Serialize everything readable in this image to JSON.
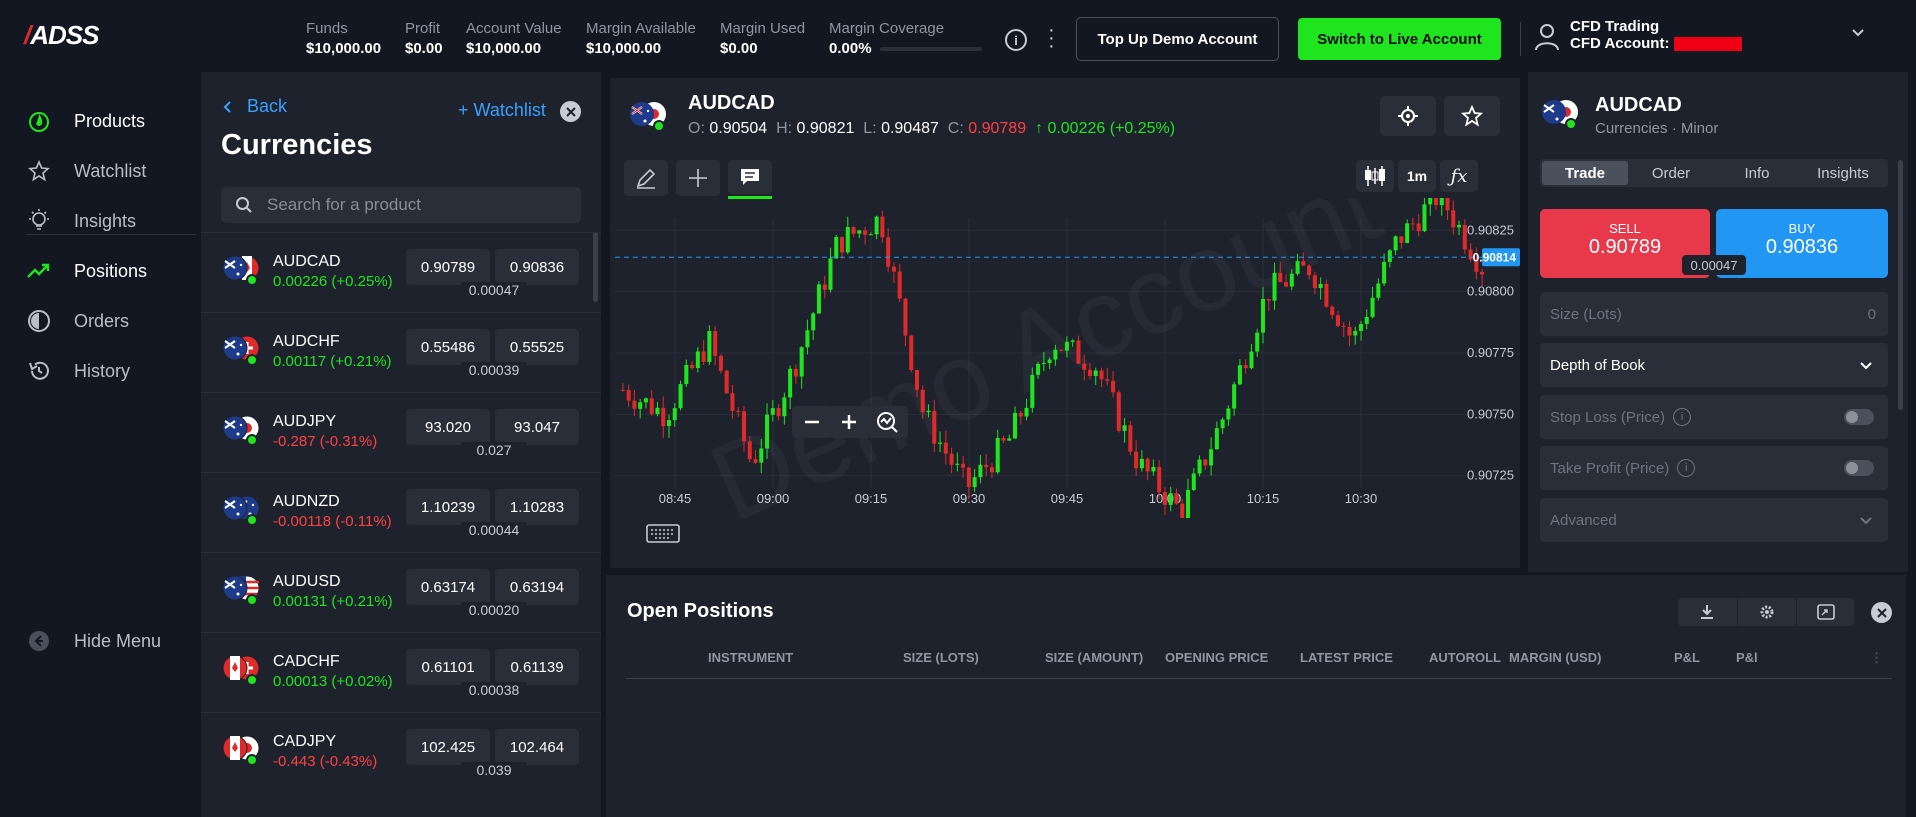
{
  "brand": {
    "logo": "ADSS"
  },
  "stats": [
    {
      "label": "Funds",
      "value": "$10,000.00"
    },
    {
      "label": "Profit",
      "value": "$0.00"
    },
    {
      "label": "Account Value",
      "value": "$10,000.00"
    },
    {
      "label": "Margin Available",
      "value": "$10,000.00"
    },
    {
      "label": "Margin Used",
      "value": "$0.00"
    },
    {
      "label": "Margin Coverage",
      "value": "0.00%"
    }
  ],
  "header": {
    "topup_label": "Top Up Demo Account",
    "live_label": "Switch to Live Account",
    "account_type": "CFD Trading",
    "account_label": "CFD Account:"
  },
  "nav": {
    "items": [
      {
        "label": "Products",
        "icon": "fire-icon"
      },
      {
        "label": "Watchlist",
        "icon": "star-icon"
      },
      {
        "label": "Insights",
        "icon": "bulb-icon"
      },
      {
        "label": "Positions",
        "icon": "trend-icon"
      },
      {
        "label": "Orders",
        "icon": "pie-icon"
      },
      {
        "label": "History",
        "icon": "history-icon"
      }
    ],
    "hide_label": "Hide Menu"
  },
  "productlist": {
    "back_label": "Back",
    "watchlist_label": "+ Watchlist",
    "title": "Currencies",
    "search_placeholder": "Search for a product",
    "items": [
      {
        "name": "AUDCAD",
        "change": "0.00226 (+0.25%)",
        "sell": "0.90789",
        "buy": "0.90836",
        "spread": "0.00047",
        "dir": "up"
      },
      {
        "name": "AUDCHF",
        "change": "0.00117 (+0.21%)",
        "sell": "0.55486",
        "buy": "0.55525",
        "spread": "0.00039",
        "dir": "up"
      },
      {
        "name": "AUDJPY",
        "change": "-0.287 (-0.31%)",
        "sell": "93.020",
        "buy": "93.047",
        "spread": "0.027",
        "dir": "dn"
      },
      {
        "name": "AUDNZD",
        "change": "-0.00118 (-0.11%)",
        "sell": "1.10239",
        "buy": "1.10283",
        "spread": "0.00044",
        "dir": "dn"
      },
      {
        "name": "AUDUSD",
        "change": "0.00131 (+0.21%)",
        "sell": "0.63174",
        "buy": "0.63194",
        "spread": "0.00020",
        "dir": "up"
      },
      {
        "name": "CADCHF",
        "change": "0.00013 (+0.02%)",
        "sell": "0.61101",
        "buy": "0.61139",
        "spread": "0.00038",
        "dir": "up"
      },
      {
        "name": "CADJPY",
        "change": "-0.443 (-0.43%)",
        "sell": "102.425",
        "buy": "102.464",
        "spread": "0.039",
        "dir": "dn"
      }
    ]
  },
  "chart": {
    "symbol": "AUDCAD",
    "o_label": "O:",
    "o": "0.90504",
    "h_label": "H:",
    "h": "0.90821",
    "l_label": "L:",
    "l": "0.90487",
    "c_label": "C:",
    "c": "0.90789",
    "change": "0.00226 (+0.25%)",
    "interval": "1m",
    "current_price": "0.90814",
    "watermark": "Demo Account"
  },
  "chart_data": {
    "type": "candlestick",
    "x_ticks": [
      "08:45",
      "09:00",
      "09:15",
      "09:30",
      "09:45",
      "10:00",
      "10:15",
      "10:30"
    ],
    "y_ticks": [
      "0.90825",
      "0.90800",
      "0.90775",
      "0.90750",
      "0.90725"
    ],
    "ylim": [
      0.9072,
      0.9083
    ],
    "current_price": 0.90814
  },
  "trade": {
    "symbol": "AUDCAD",
    "subtitle": "Currencies · Minor",
    "tabs": [
      "Trade",
      "Order",
      "Info",
      "Insights"
    ],
    "sell_label": "SELL",
    "sell_price": "0.90789",
    "buy_label": "BUY",
    "buy_price": "0.90836",
    "spread": "0.00047",
    "size_label": "Size (Lots)",
    "size_value": "0",
    "depth_label": "Depth of Book",
    "stoploss_label": "Stop Loss (Price)",
    "takeprofit_label": "Take Profit (Price)",
    "advanced_label": "Advanced"
  },
  "positions": {
    "title": "Open Positions",
    "columns": [
      "INSTRUMENT",
      "SIZE (LOTS)",
      "SIZE (AMOUNT)",
      "OPENING PRICE",
      "LATEST PRICE",
      "AUTOROLL",
      "MARGIN (USD)",
      "P&L",
      "P&l"
    ]
  }
}
